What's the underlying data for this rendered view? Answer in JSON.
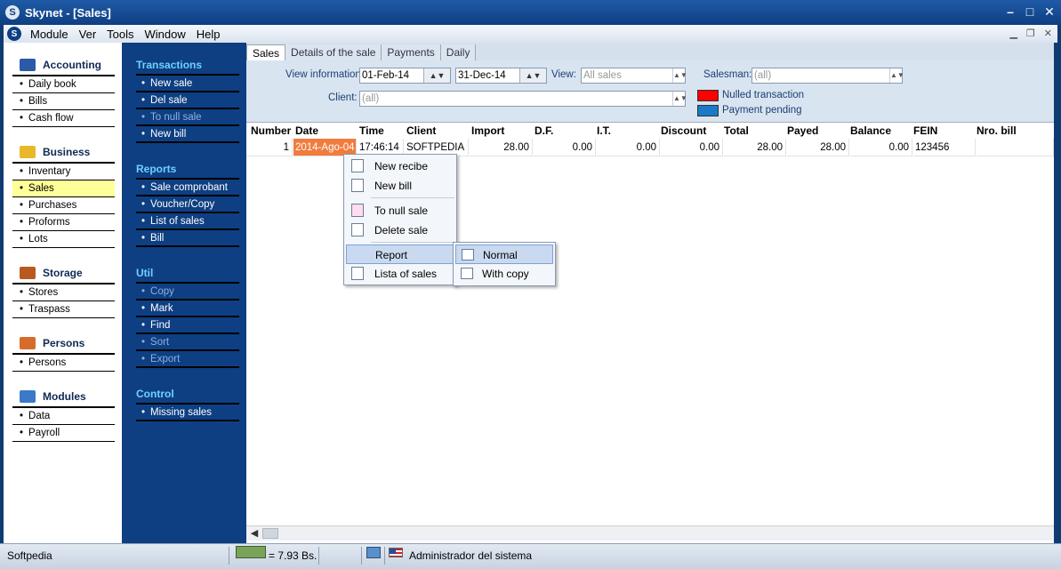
{
  "window": {
    "title": "Skynet - [Sales]",
    "app_icon": "S"
  },
  "menu": {
    "items": [
      "Module",
      "Ver",
      "Tools",
      "Window",
      "Help"
    ]
  },
  "left": {
    "sections": [
      {
        "title": "Accounting",
        "icon": "book-icon",
        "color": "#2a5aa8",
        "items": [
          "Daily book",
          "Bills",
          "Cash flow"
        ]
      },
      {
        "title": "Business",
        "icon": "coins-icon",
        "color": "#e8b828",
        "items": [
          "Inventary",
          "Sales",
          "Purchases",
          "Proforms",
          "Lots"
        ],
        "active_index": 1
      },
      {
        "title": "Storage",
        "icon": "briefcase-icon",
        "color": "#b85a20",
        "items": [
          "Stores",
          "Traspass"
        ]
      },
      {
        "title": "Persons",
        "icon": "people-icon",
        "color": "#d86a2a",
        "items": [
          "Persons"
        ]
      },
      {
        "title": "Modules",
        "icon": "modules-icon",
        "color": "#3a7ac8",
        "items": [
          "Data",
          "Payroll"
        ]
      }
    ]
  },
  "tasks": {
    "sections": [
      {
        "title": "Transactions",
        "items": [
          {
            "label": "New sale",
            "enabled": true
          },
          {
            "label": "Del sale",
            "enabled": true
          },
          {
            "label": "To null sale",
            "enabled": false
          },
          {
            "label": "New bill",
            "enabled": true
          }
        ]
      },
      {
        "title": "Reports",
        "items": [
          {
            "label": "Sale comprobant",
            "enabled": true
          },
          {
            "label": "Voucher/Copy",
            "enabled": true
          },
          {
            "label": "List of sales",
            "enabled": true
          },
          {
            "label": "Bill",
            "enabled": true
          }
        ]
      },
      {
        "title": "Util",
        "items": [
          {
            "label": "Copy",
            "enabled": false
          },
          {
            "label": "Mark",
            "enabled": true
          },
          {
            "label": "Find",
            "enabled": true
          },
          {
            "label": "Sort",
            "enabled": false
          },
          {
            "label": "Export",
            "enabled": false
          }
        ]
      },
      {
        "title": "Control",
        "items": [
          {
            "label": "Missing sales",
            "enabled": true
          }
        ]
      }
    ]
  },
  "tabs": [
    "Sales",
    "Details of the sale",
    "Payments",
    "Daily"
  ],
  "filters": {
    "view_info_label": "View information",
    "date_from": "01-Feb-14",
    "date_to": "31-Dec-14",
    "view_label": "View:",
    "view_value": "All sales",
    "salesman_label": "Salesman:",
    "salesman_value": "(all)",
    "client_label": "Client:",
    "client_value": "(all)"
  },
  "legend": [
    {
      "label": "Nulled transaction",
      "color": "#ff0000"
    },
    {
      "label": "Payment pending",
      "color": "#1a7ac8"
    }
  ],
  "grid": {
    "columns": [
      "Number",
      "Date",
      "Time",
      "Client",
      "Import",
      "D.F.",
      "I.T.",
      "Discount",
      "Total",
      "Payed",
      "Balance",
      "FEIN",
      "Nro. bill"
    ],
    "rows": [
      [
        "1",
        "2014-Ago-04",
        "17:46:14",
        "SOFTPEDIA",
        "28.00",
        "0.00",
        "0.00",
        "0.00",
        "28.00",
        "28.00",
        "0.00",
        "123456",
        ""
      ]
    ]
  },
  "context_menu": {
    "items": [
      "New recibe",
      "New bill",
      "To null sale",
      "Delete sale",
      "Report",
      "Lista of sales"
    ],
    "submenu": [
      "Normal",
      "With copy"
    ]
  },
  "status": {
    "left_text": "Softpedia",
    "currency": "= 7.93 Bs.",
    "user": "Administrador del sistema"
  }
}
